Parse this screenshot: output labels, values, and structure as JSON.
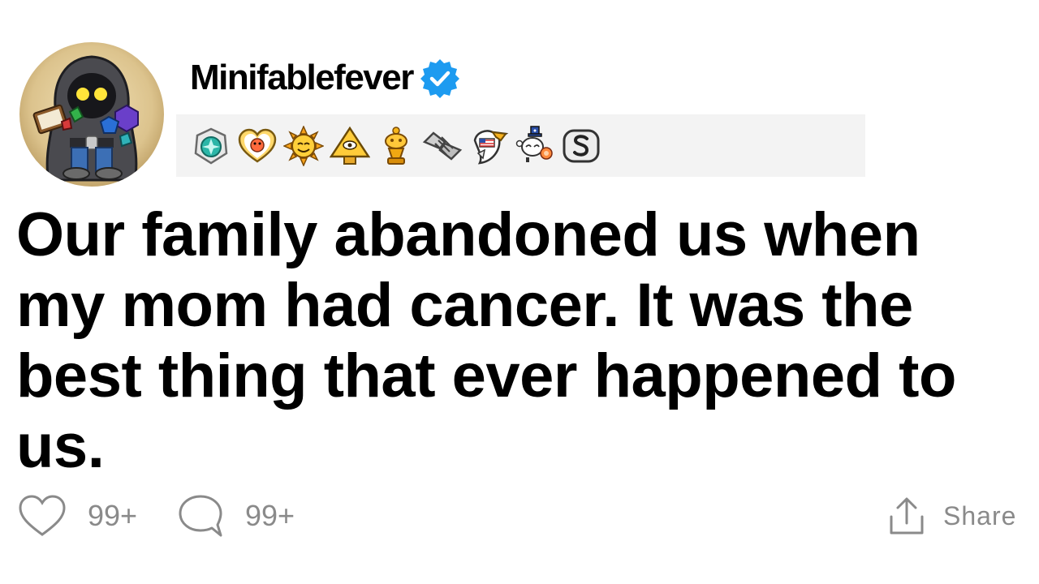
{
  "post": {
    "username": "Minifablefever",
    "verified": true,
    "title": "Our family abandoned us when my mom had cancer. It was the best thing that ever happened to us.",
    "awards": [
      "silver-medal-award-icon",
      "wholesome-award-icon",
      "sun-award-icon",
      "pyramid-eye-award-icon",
      "gold-trophy-award-icon",
      "handshake-award-icon",
      "eagle-flag-award-icon",
      "snoo-uncle-sam-award-icon",
      "silver-s-award-icon"
    ]
  },
  "actions": {
    "likes": "99+",
    "comments": "99+",
    "share_label": "Share"
  },
  "colors": {
    "verified_blue": "#1d9bf0",
    "icon_gray": "#8a8a8a",
    "awards_bar_bg": "#f3f3f3"
  }
}
